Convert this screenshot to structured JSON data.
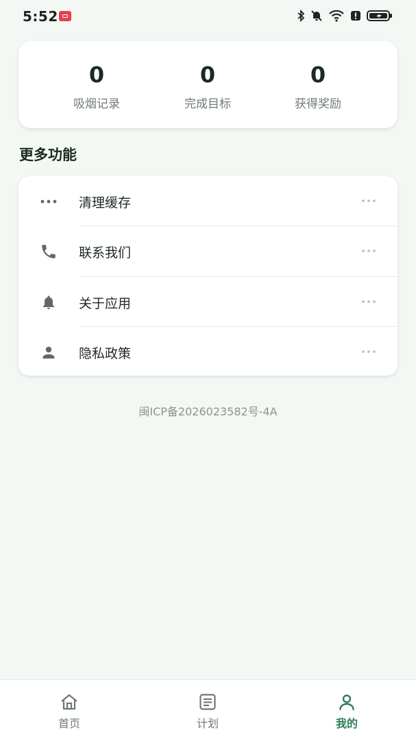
{
  "status_bar": {
    "time": "5:52"
  },
  "stats": [
    {
      "value": "0",
      "label": "吸烟记录"
    },
    {
      "value": "0",
      "label": "完成目标"
    },
    {
      "value": "0",
      "label": "获得奖励"
    }
  ],
  "section_title": "更多功能",
  "menu": [
    {
      "label": "清理缓存",
      "icon": "more-horiz-icon"
    },
    {
      "label": "联系我们",
      "icon": "phone-icon"
    },
    {
      "label": "关于应用",
      "icon": "bell-icon"
    },
    {
      "label": "隐私政策",
      "icon": "person-icon"
    }
  ],
  "icp": "闽ICP备2026023582号-4A",
  "bottom_nav": [
    {
      "label": "首页",
      "icon": "home-icon",
      "active": false
    },
    {
      "label": "计划",
      "icon": "list-icon",
      "active": false
    },
    {
      "label": "我的",
      "icon": "person-icon",
      "active": true
    }
  ],
  "colors": {
    "accent": "#2e7d5b",
    "background": "#f4f8f4"
  }
}
